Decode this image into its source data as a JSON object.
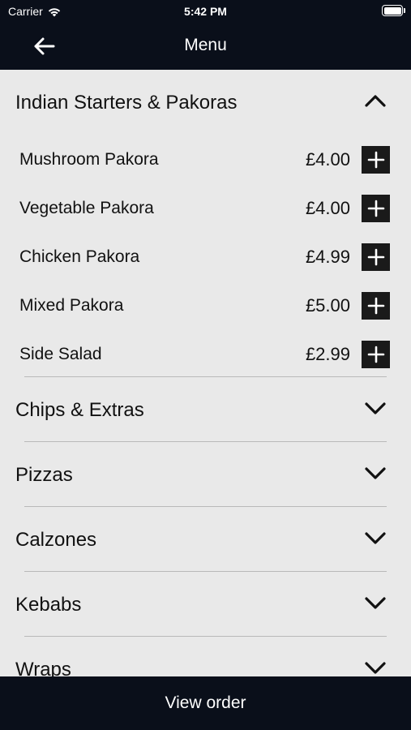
{
  "status": {
    "carrier": "Carrier",
    "time": "5:42 PM"
  },
  "nav": {
    "title": "Menu"
  },
  "expanded_category": {
    "title": "Indian Starters & Pakoras",
    "items": [
      {
        "name": "Mushroom Pakora",
        "price": "£4.00"
      },
      {
        "name": "Vegetable Pakora",
        "price": "£4.00"
      },
      {
        "name": "Chicken Pakora",
        "price": "£4.99"
      },
      {
        "name": "Mixed Pakora",
        "price": "£5.00"
      },
      {
        "name": "Side Salad",
        "price": "£2.99"
      }
    ]
  },
  "categories": [
    {
      "title": "Chips & Extras"
    },
    {
      "title": "Pizzas"
    },
    {
      "title": "Calzones"
    },
    {
      "title": "Kebabs"
    },
    {
      "title": "Wraps"
    }
  ],
  "footer": {
    "label": "View order"
  },
  "colors": {
    "bar": "#0a0f1a",
    "background": "#e9e9e9",
    "button": "#1a1a1a"
  },
  "icons": {
    "back": "arrow-left-icon",
    "expanded": "chevron-up-icon",
    "collapsed": "chevron-down-icon",
    "add": "plus-icon"
  }
}
